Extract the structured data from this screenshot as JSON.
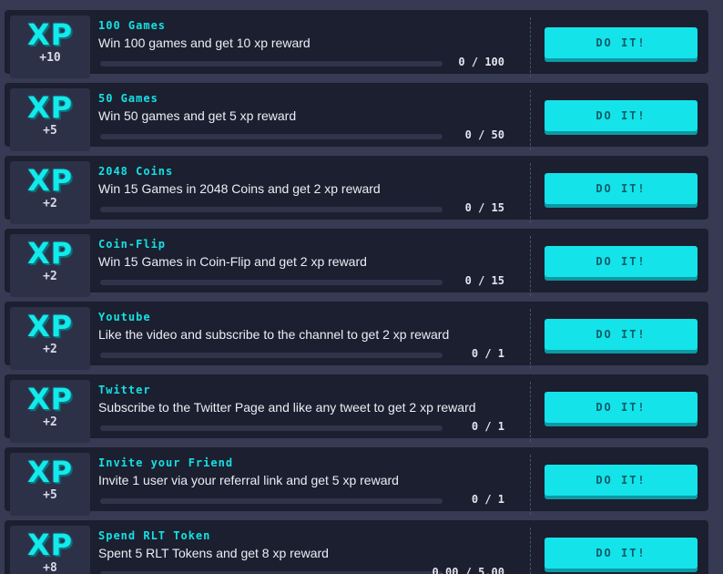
{
  "colors": {
    "accent": "#14e3ea",
    "row_background": "#1c1f2f",
    "page_background": "#363a52",
    "badge_background": "#2d3147",
    "progress_track": "#30344b"
  },
  "quests": [
    {
      "badge_label": "XP",
      "badge_amount": "+10",
      "title": "100 Games",
      "description": "Win 100 games and get 10 xp reward",
      "progress_text": "0 / 100",
      "progress_fraction": 0,
      "button_label": "DO IT!"
    },
    {
      "badge_label": "XP",
      "badge_amount": "+5",
      "title": "50 Games",
      "description": "Win 50 games and get 5 xp reward",
      "progress_text": "0 / 50",
      "progress_fraction": 0,
      "button_label": "DO IT!"
    },
    {
      "badge_label": "XP",
      "badge_amount": "+2",
      "title": "2048 Coins",
      "description": "Win 15 Games in 2048 Coins and get 2 xp reward",
      "progress_text": "0 / 15",
      "progress_fraction": 0,
      "button_label": "DO IT!"
    },
    {
      "badge_label": "XP",
      "badge_amount": "+2",
      "title": "Coin-Flip",
      "description": "Win 15 Games in Coin-Flip and get 2 xp reward",
      "progress_text": "0 / 15",
      "progress_fraction": 0,
      "button_label": "DO IT!"
    },
    {
      "badge_label": "XP",
      "badge_amount": "+2",
      "title": "Youtube",
      "description": "Like the video and subscribe to the channel to get 2 xp reward",
      "progress_text": "0 / 1",
      "progress_fraction": 0,
      "button_label": "DO IT!"
    },
    {
      "badge_label": "XP",
      "badge_amount": "+2",
      "title": "Twitter",
      "description": "Subscribe to the Twitter Page and like any tweet to get 2 xp reward",
      "progress_text": "0 / 1",
      "progress_fraction": 0,
      "button_label": "DO IT!"
    },
    {
      "badge_label": "XP",
      "badge_amount": "+5",
      "title": "Invite your Friend",
      "description": "Invite 1 user via your referral link and get 5 xp reward",
      "progress_text": "0 / 1",
      "progress_fraction": 0,
      "button_label": "DO IT!"
    },
    {
      "badge_label": "XP",
      "badge_amount": "+8",
      "title": "Spend RLT Token",
      "description": "Spent 5 RLT Tokens and get 8 xp reward",
      "progress_text": "0.00 / 5.00",
      "progress_fraction": 0,
      "button_label": "DO IT!"
    }
  ]
}
